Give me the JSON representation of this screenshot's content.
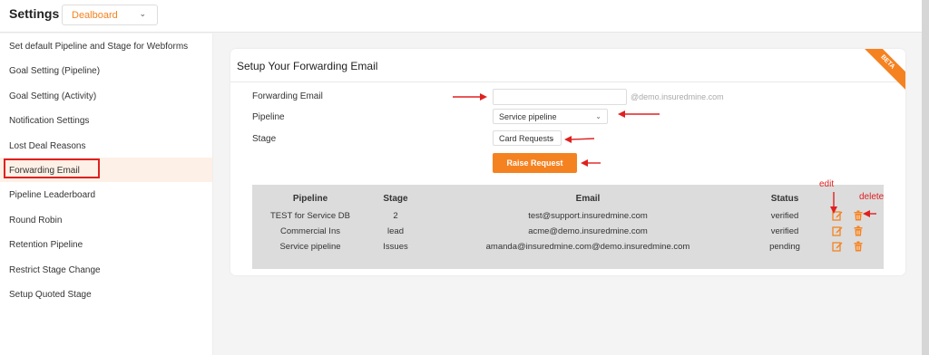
{
  "header": {
    "title": "Settings",
    "dropdown_value": "Dealboard"
  },
  "sidebar": {
    "items": [
      {
        "label": "Set default Pipeline and Stage for Webforms",
        "active": false
      },
      {
        "label": "Goal Setting (Pipeline)",
        "active": false
      },
      {
        "label": "Goal Setting (Activity)",
        "active": false
      },
      {
        "label": "Notification Settings",
        "active": false
      },
      {
        "label": "Lost Deal Reasons",
        "active": false
      },
      {
        "label": "Forwarding Email",
        "active": true
      },
      {
        "label": "Pipeline Leaderboard",
        "active": false
      },
      {
        "label": "Round Robin",
        "active": false
      },
      {
        "label": "Retention Pipeline",
        "active": false
      },
      {
        "label": "Restrict Stage Change",
        "active": false
      },
      {
        "label": "Setup Quoted Stage",
        "active": false
      }
    ]
  },
  "card": {
    "title": "Setup Your Forwarding Email",
    "badge": "BETA",
    "form": {
      "forwarding_email_label": "Forwarding Email",
      "forwarding_email_value": "",
      "domain_suffix": "@demo.insuredmine.com",
      "pipeline_label": "Pipeline",
      "pipeline_value": "Service pipeline",
      "stage_label": "Stage",
      "stage_value": "Card Requests",
      "raise_button": "Raise Request"
    },
    "table": {
      "headers": [
        "Pipeline",
        "Stage",
        "Email",
        "Status"
      ],
      "rows": [
        {
          "pipeline": "TEST for Service DB",
          "stage": "2",
          "email": "test@support.insuredmine.com",
          "status": "verified"
        },
        {
          "pipeline": "Commercial Ins",
          "stage": "lead",
          "email": "acme@demo.insuredmine.com",
          "status": "verified"
        },
        {
          "pipeline": "Service pipeline",
          "stage": "Issues",
          "email": "amanda@insuredmine.com@demo.insuredmine.com",
          "status": "pending"
        }
      ]
    }
  },
  "annotations": {
    "edit": "edit",
    "delete": "delete"
  },
  "colors": {
    "accent": "#f58220",
    "annotation_red": "#e02020"
  },
  "icons": {
    "edit": "edit-icon",
    "delete": "trash-icon",
    "chevron": "chevron-down-icon"
  }
}
